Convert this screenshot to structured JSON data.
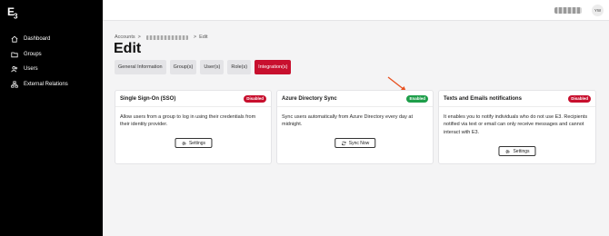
{
  "brand": {
    "logo_text": "E",
    "logo_sub": "3"
  },
  "sidebar": {
    "items": [
      {
        "label": "Dashboard",
        "icon": "home-icon"
      },
      {
        "label": "Groups",
        "icon": "folder-icon"
      },
      {
        "label": "Users",
        "icon": "users-icon"
      },
      {
        "label": "External Relations",
        "icon": "network-icon"
      }
    ]
  },
  "topbar": {
    "avatar_initials": "YW"
  },
  "breadcrumb": {
    "root": "Accounts",
    "current": "Edit"
  },
  "page": {
    "title": "Edit"
  },
  "tabs": [
    {
      "label": "General Information",
      "active": false
    },
    {
      "label": "Group(s)",
      "active": false
    },
    {
      "label": "User(s)",
      "active": false
    },
    {
      "label": "Role(s)",
      "active": false
    },
    {
      "label": "Integration(s)",
      "active": true
    }
  ],
  "cards": [
    {
      "title": "Single Sign-On (SSO)",
      "status": "Disabled",
      "description": "Allow users from a group to log in using their credentials from their identity provider.",
      "button": "Settings",
      "button_icon": "gear-icon"
    },
    {
      "title": "Azure Directory Sync",
      "status": "Enabled",
      "description": "Sync users automatically from Azure Directory every day at midnight.",
      "button": "Sync Now",
      "button_icon": "refresh-icon"
    },
    {
      "title": "Texts and Emails notifications",
      "status": "Disabled",
      "description": "It enables you to notify individuals who do not use E3. Recipients notified via text or email can only receive messages and cannot interact with E3.",
      "button": "Settings",
      "button_icon": "gear-icon"
    }
  ],
  "colors": {
    "accent": "#c8102e",
    "enabled": "#1e9e4a",
    "sidebar": "#000000"
  }
}
